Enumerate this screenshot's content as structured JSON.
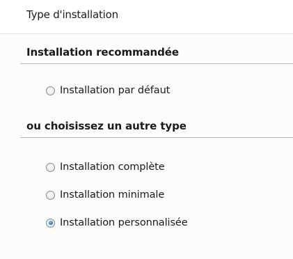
{
  "window": {
    "title": "Type d'installation"
  },
  "recommended": {
    "heading": "Installation recommandée",
    "options": [
      {
        "label": "Installation par défaut",
        "checked": false
      }
    ]
  },
  "other": {
    "heading": "ou choisissez un autre type",
    "options": [
      {
        "label": "Installation complète",
        "checked": false
      },
      {
        "label": "Installation minimale",
        "checked": false
      },
      {
        "label": "Installation personnalisée",
        "checked": true
      }
    ]
  },
  "colors": {
    "radio_dot": "#2a7ad5",
    "rule": "#b4b4b4"
  }
}
